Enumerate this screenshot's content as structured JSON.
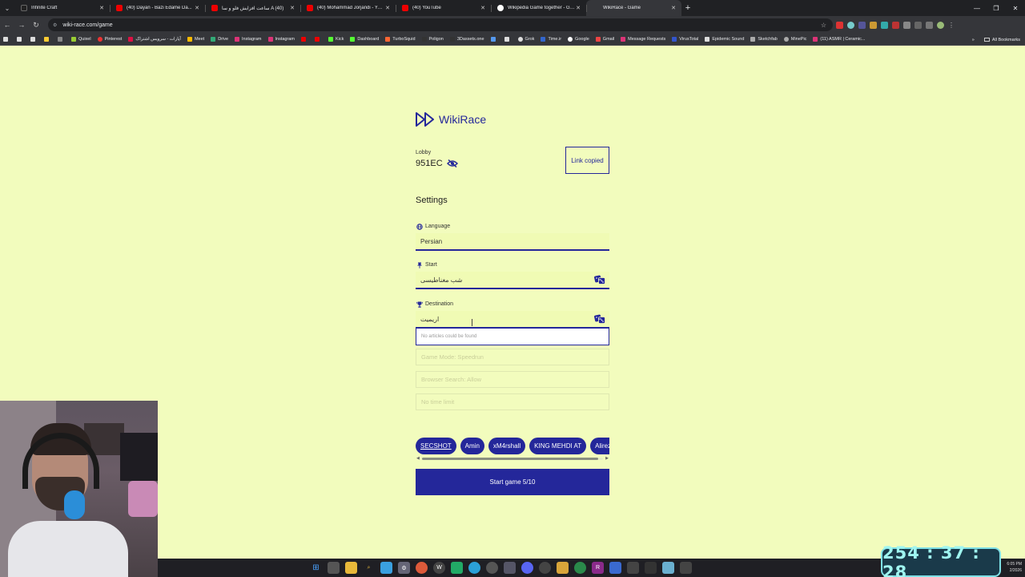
{
  "browser": {
    "tabs": [
      {
        "title": "Infinite Craft",
        "active": false
      },
      {
        "title": "(40) Dayan - Bazi Edame Da...",
        "active": false
      },
      {
        "title": "ساعت افزایش فلو و سا A (40)",
        "active": false
      },
      {
        "title": "(40) Mohammad Jorjandi - You...",
        "active": false
      },
      {
        "title": "(40) YouTube",
        "active": false
      },
      {
        "title": "Wikipedia Game together - Go...",
        "active": false
      },
      {
        "title": "WikiRace - Game",
        "active": true
      }
    ],
    "url": "wiki-race.com/game",
    "bookmarks": [
      "Quixel",
      "Pinterest",
      "آپارات - سرویس اشتراک",
      "Meet",
      "Drive",
      "Instagram",
      "Instagram",
      "Kick",
      "Dashboard",
      "TurboSquid",
      "Poligon",
      "3Dassets.one",
      "Grok",
      "Time.ir",
      "Google",
      "Gmail",
      "Message Requests",
      "VirusTotal",
      "Epidemic Sound",
      "Sketchfab",
      "MinePic",
      "(11) ASMR | Ceramic..."
    ],
    "all_bookmarks": "All Bookmarks"
  },
  "app": {
    "brand": "WikiRace",
    "lobby_label": "Lobby",
    "lobby_code": "951EC",
    "link_button": "Link copied",
    "settings_title": "Settings",
    "language": {
      "label": "Language",
      "value": "Persian"
    },
    "start": {
      "label": "Start",
      "value": "شب مغناطیسی"
    },
    "destination": {
      "label": "Destination",
      "value": "اریمیت",
      "dropdown_message": "No articles could be found"
    },
    "game_mode": "Game Mode: Speedrun",
    "browser_search": "Browser Search: Allow",
    "time_limit": "No time limit",
    "players": [
      "SECSHOT",
      "Amin",
      "xM4rshall",
      "KING MEHDI AT",
      "Alirezaw"
    ],
    "start_button": "Start game 5/10"
  },
  "overlay": {
    "timer": "254 : 37 : 28"
  },
  "taskbar": {
    "time": "6:05 PM",
    "date": "2/2026"
  },
  "colors": {
    "page_bg": "#f2fcbd",
    "accent": "#24279a",
    "field_bg": "#f0fbb4"
  }
}
